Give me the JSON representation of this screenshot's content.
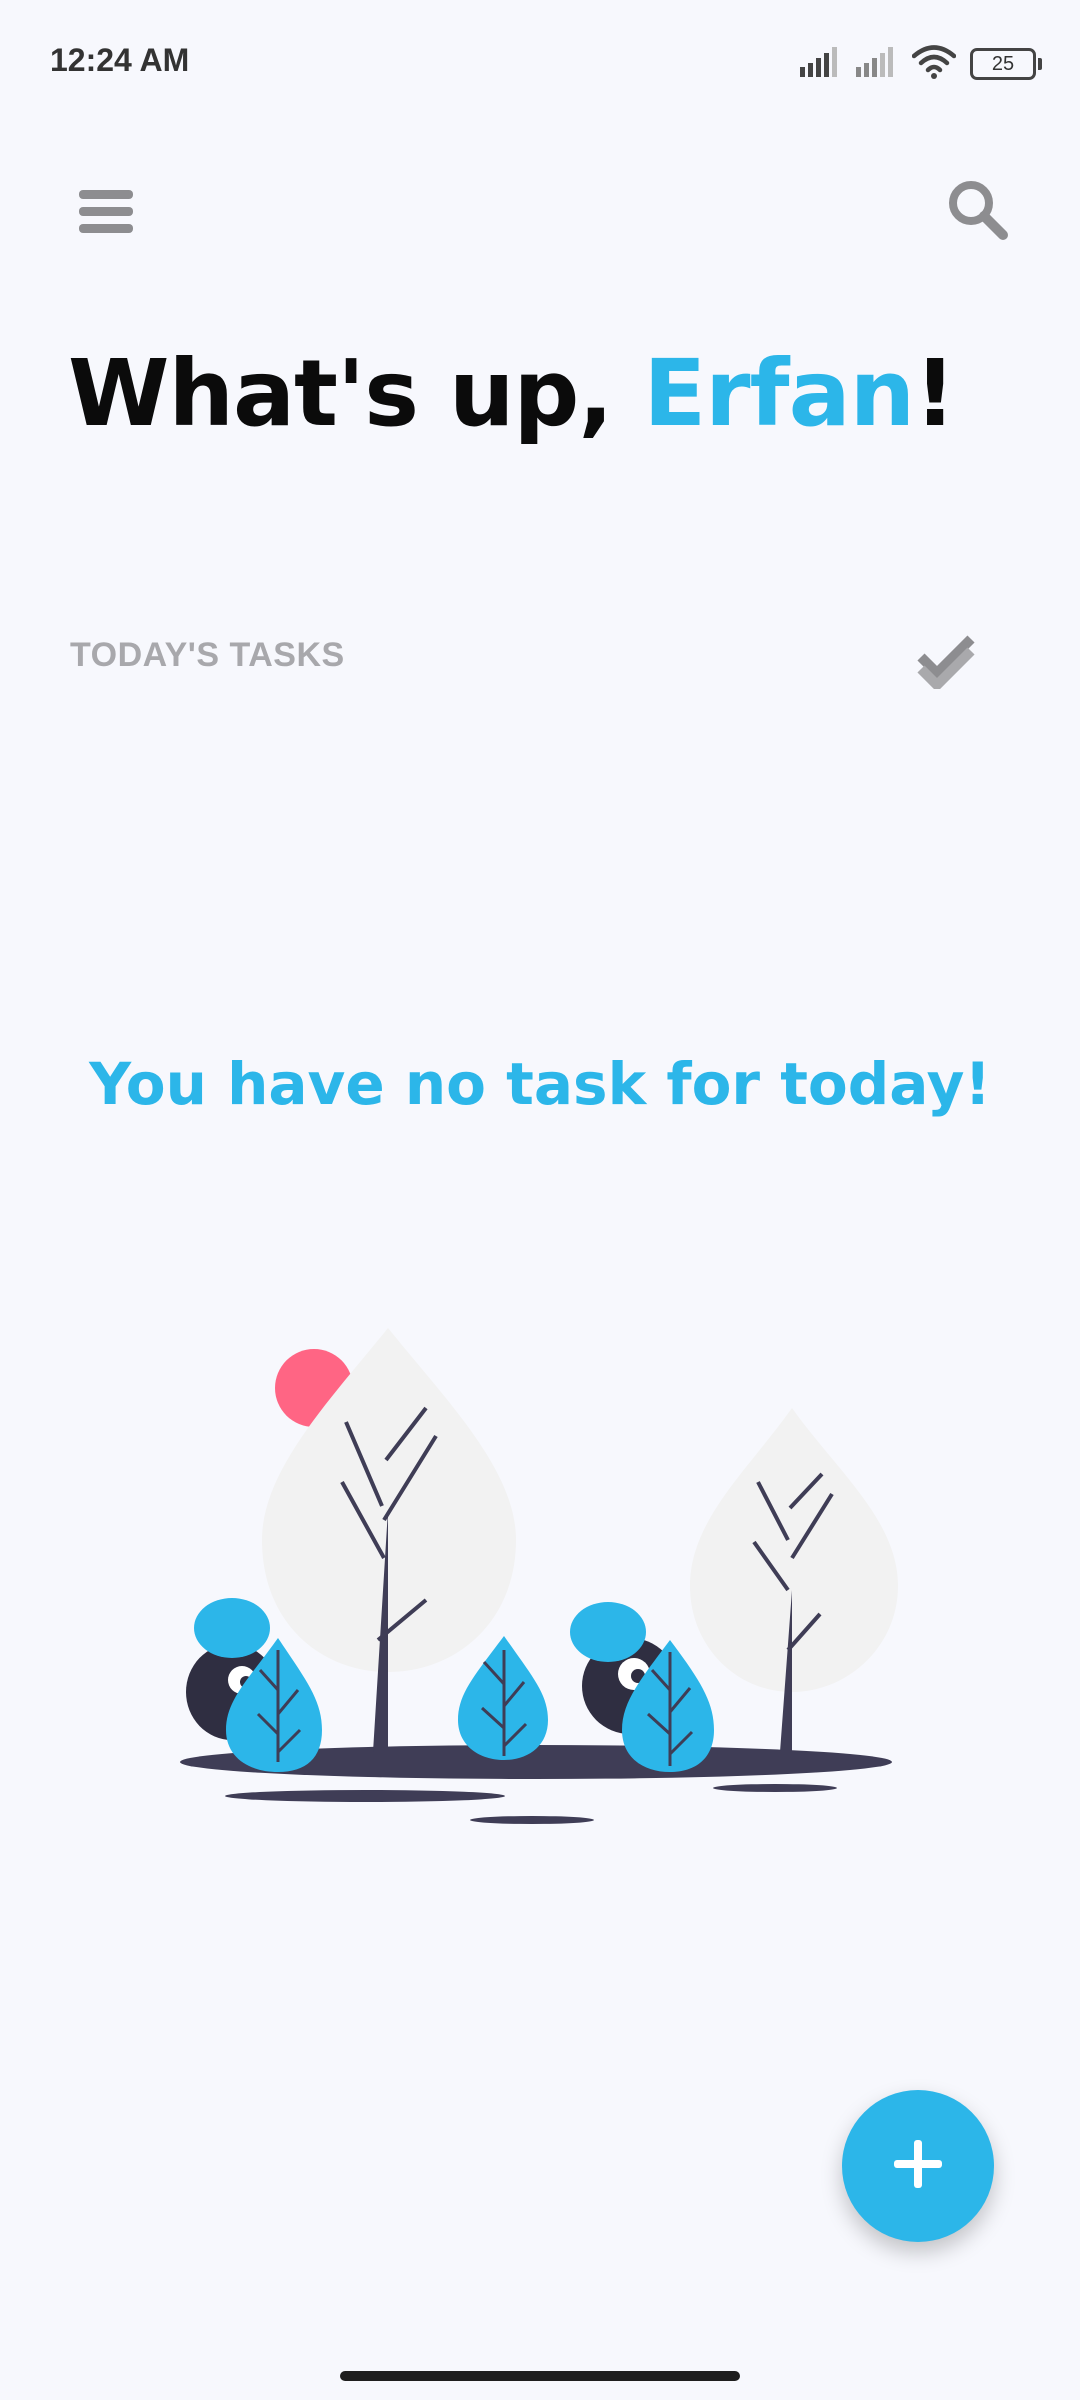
{
  "status_bar": {
    "time": "12:24 AM",
    "battery_level": "25",
    "icons": [
      "signal-icon",
      "signal-icon",
      "wifi-icon",
      "battery-icon"
    ]
  },
  "toolbar": {
    "menu_icon": "menu-icon",
    "search_icon": "search-icon"
  },
  "greeting": {
    "prefix": "What's up, ",
    "name": "Erfan",
    "suffix": "!"
  },
  "tasks": {
    "header": "TODAY'S TASKS",
    "mark_all_icon": "double-check-icon",
    "empty_message": "You have no task for today!"
  },
  "fab": {
    "icon": "plus-icon"
  },
  "colors": {
    "accent": "#2cb6e9",
    "background": "#f7f8fd",
    "muted": "#a8a8ac",
    "dark": "#3f3d56",
    "pink": "#ff6584"
  }
}
